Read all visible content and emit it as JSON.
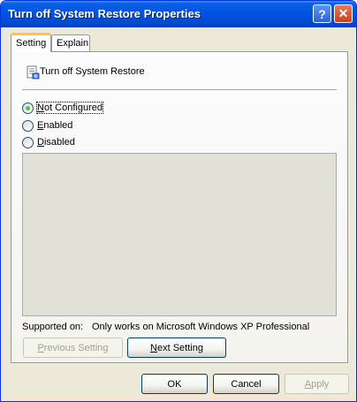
{
  "window": {
    "title": "Turn off System Restore Properties",
    "help_glyph": "?",
    "close_glyph": "✕"
  },
  "tabs": [
    {
      "label": "Setting",
      "selected": true
    },
    {
      "label": "Explain",
      "selected": false
    }
  ],
  "setting": {
    "policy_name": "Turn off System Restore",
    "options": [
      {
        "label_prefix": "",
        "accel": "N",
        "label_rest": "ot Configured",
        "checked": true
      },
      {
        "label_prefix": "",
        "accel": "E",
        "label_rest": "nabled",
        "checked": false
      },
      {
        "label_prefix": "",
        "accel": "D",
        "label_rest": "isabled",
        "checked": false
      }
    ],
    "supported_label": "Supported on:",
    "supported_value": "Only works on Microsoft Windows XP Professional",
    "previous_button": {
      "label_prefix": "",
      "accel": "P",
      "label_rest": "revious Setting",
      "enabled": false
    },
    "next_button": {
      "label_prefix": "",
      "accel": "N",
      "label_rest": "ext Setting",
      "enabled": true
    }
  },
  "footer": {
    "ok_label": "OK",
    "cancel_label": "Cancel",
    "apply": {
      "label_prefix": "",
      "accel": "A",
      "label_rest": "pply",
      "enabled": false
    }
  }
}
